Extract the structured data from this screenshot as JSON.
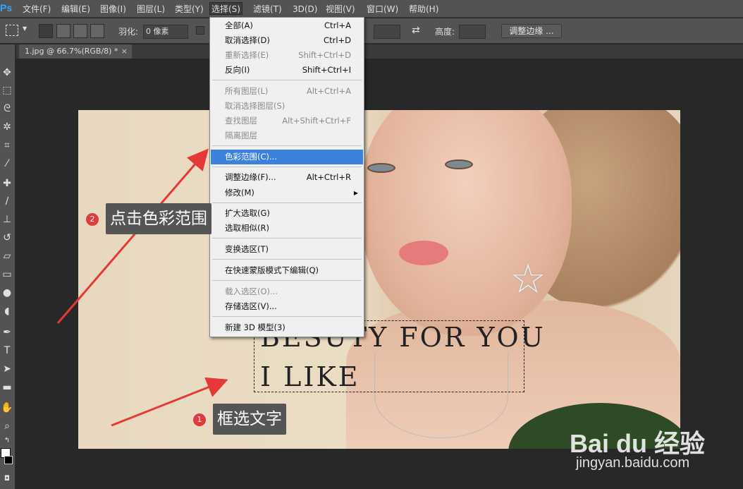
{
  "menubar": {
    "logo": "Ps",
    "items": [
      "文件(F)",
      "编辑(E)",
      "图像(I)",
      "图层(L)",
      "类型(Y)",
      "选择(S)",
      "滤镜(T)",
      "3D(D)",
      "视图(V)",
      "窗口(W)",
      "帮助(H)"
    ]
  },
  "options": {
    "feather_label": "羽化:",
    "feather_value": "0 像素",
    "height_label": "高度:",
    "refine_button": "调整边缘 ..."
  },
  "document": {
    "tab_title": "1.jpg @ 66.7%(RGB/8) *",
    "close": "×"
  },
  "canvas_text": {
    "line1": "BESUTY FOR YOU",
    "line2": "I LIKE"
  },
  "select_menu": {
    "items": [
      {
        "label": "全部(A)",
        "shortcut": "Ctrl+A"
      },
      {
        "label": "取消选择(D)",
        "shortcut": "Ctrl+D"
      },
      {
        "label": "重新选择(E)",
        "shortcut": "Shift+Ctrl+D"
      },
      {
        "label": "反向(I)",
        "shortcut": "Shift+Ctrl+I"
      },
      {
        "label": "所有图层(L)",
        "shortcut": "Alt+Ctrl+A"
      },
      {
        "label": "取消选择图层(S)",
        "shortcut": ""
      },
      {
        "label": "查找图层",
        "shortcut": "Alt+Shift+Ctrl+F"
      },
      {
        "label": "隔离图层",
        "shortcut": ""
      },
      {
        "label": "色彩范围(C)...",
        "shortcut": ""
      },
      {
        "label": "调整边缘(F)...",
        "shortcut": "Alt+Ctrl+R"
      },
      {
        "label": "修改(M)",
        "shortcut": ""
      },
      {
        "label": "扩大选取(G)",
        "shortcut": ""
      },
      {
        "label": "选取相似(R)",
        "shortcut": ""
      },
      {
        "label": "变换选区(T)",
        "shortcut": ""
      },
      {
        "label": "在快速蒙版模式下编辑(Q)",
        "shortcut": ""
      },
      {
        "label": "载入选区(O)...",
        "shortcut": ""
      },
      {
        "label": "存储选区(V)...",
        "shortcut": ""
      },
      {
        "label": "新建 3D 模型(3)",
        "shortcut": ""
      }
    ]
  },
  "annotations": {
    "step1_num": "1",
    "step1_text": "框选文字",
    "step2_num": "2",
    "step2_text": "点击色彩范围"
  },
  "watermark": {
    "logo": "Bai du 经验",
    "url": "jingyan.baidu.com"
  },
  "colors": {
    "menu_highlight": "#3c82dc",
    "annotation_red": "#e03a3a",
    "arrow_red": "#e53935"
  }
}
